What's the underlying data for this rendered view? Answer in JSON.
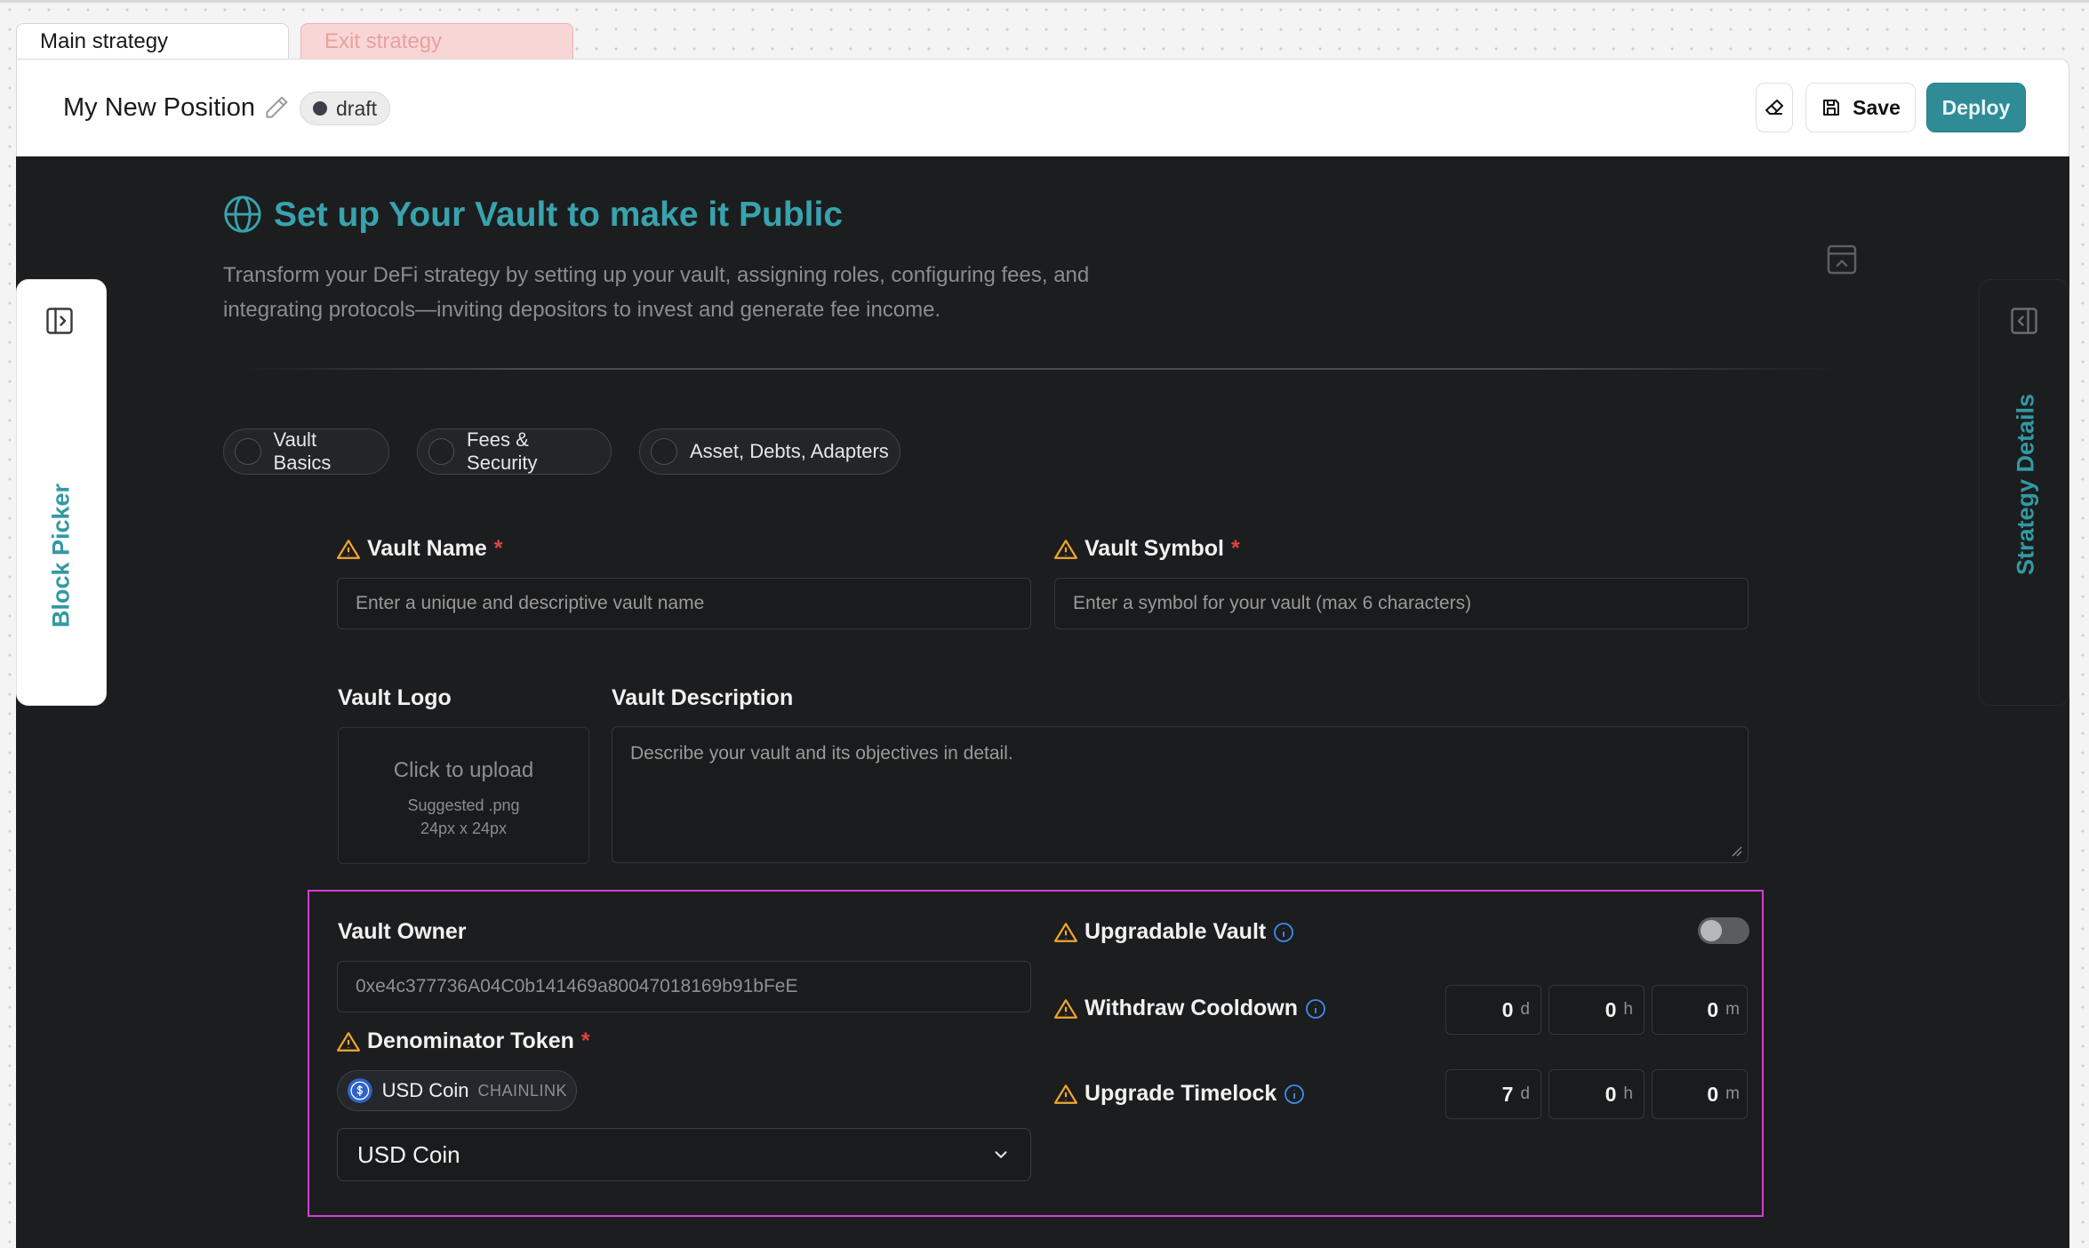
{
  "tabs": {
    "main": "Main strategy",
    "exit": "Exit strategy"
  },
  "header": {
    "title": "My New Position",
    "status": "draft",
    "save_label": "Save",
    "deploy_label": "Deploy"
  },
  "side": {
    "block_picker": "Block Picker",
    "strategy_details": "Strategy Details"
  },
  "hero": {
    "title": "Set up Your Vault to make it Public",
    "desc_line1": "Transform your DeFi strategy by setting up your vault, assigning roles, configuring fees, and",
    "desc_line2": "integrating protocols—inviting depositors to invest and generate fee income."
  },
  "steps": [
    "Vault Basics",
    "Fees & Security",
    "Asset, Debts, Adapters"
  ],
  "form": {
    "vault_name": {
      "label": "Vault Name",
      "required": "*",
      "placeholder": "Enter a unique and descriptive vault name"
    },
    "vault_symbol": {
      "label": "Vault Symbol",
      "required": "*",
      "placeholder": "Enter a symbol for your vault (max 6 characters)"
    },
    "vault_logo": {
      "label": "Vault Logo",
      "upload_text": "Click to upload",
      "hint_line1": "Suggested .png",
      "hint_line2": "24px x 24px"
    },
    "vault_description": {
      "label": "Vault Description",
      "placeholder": "Describe your vault and its objectives in detail."
    },
    "vault_owner": {
      "label": "Vault Owner",
      "value": "0xe4c377736A04C0b141469a80047018169b91bFeE"
    },
    "denominator_token": {
      "label": "Denominator Token",
      "required": "*",
      "chip_name": "USD Coin",
      "chip_source": "CHAINLINK",
      "selected": "USD Coin"
    },
    "upgradable_vault": {
      "label": "Upgradable Vault",
      "enabled": false
    },
    "withdraw_cooldown": {
      "label": "Withdraw Cooldown",
      "days": "0",
      "hours": "0",
      "minutes": "0"
    },
    "upgrade_timelock": {
      "label": "Upgrade Timelock",
      "days": "7",
      "hours": "0",
      "minutes": "0"
    },
    "units": {
      "d": "d",
      "h": "h",
      "m": "m"
    }
  },
  "colors": {
    "accent": "#38a3ad",
    "warning": "#f0a531",
    "required": "#e0443e",
    "highlight": "#d33ed3",
    "deploy": "#2f8c97"
  }
}
